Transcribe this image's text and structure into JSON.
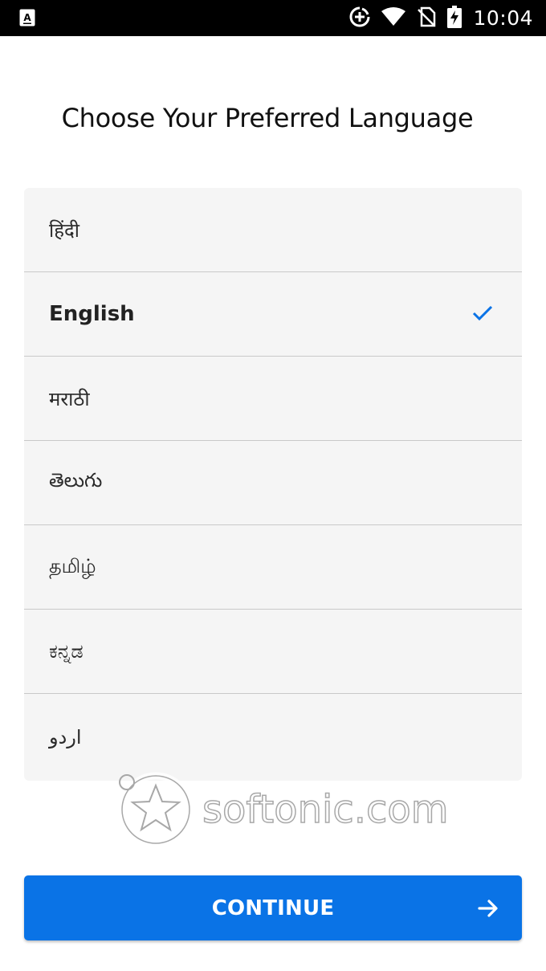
{
  "status_bar": {
    "time": "10:04",
    "icons": [
      "accessibility-a-icon",
      "data-saver-icon",
      "wifi-icon",
      "no-sim-icon",
      "battery-charging-icon"
    ]
  },
  "page": {
    "title": "Choose Your Preferred Language"
  },
  "languages": [
    {
      "label": "हिंदी",
      "selected": false
    },
    {
      "label": "English",
      "selected": true
    },
    {
      "label": "मराठी",
      "selected": false
    },
    {
      "label": "తెలుగు",
      "selected": false
    },
    {
      "label": "தமிழ்",
      "selected": false
    },
    {
      "label": "ಕನ್ನಡ",
      "selected": false
    },
    {
      "label": "اردو",
      "selected": false
    }
  ],
  "watermark": {
    "text": "softonic.com"
  },
  "continue_button": {
    "label": "CONTINUE"
  },
  "colors": {
    "accent": "#0a73e6",
    "list_background": "#f5f5f5",
    "divider": "#c9c9c9"
  }
}
